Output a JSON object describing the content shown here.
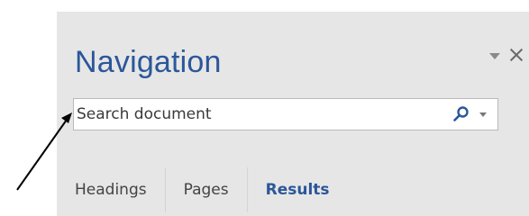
{
  "pane": {
    "title": "Navigation",
    "controls": {
      "options_icon": "dropdown-caret",
      "close_icon": "close-x"
    }
  },
  "search": {
    "placeholder": "Search document",
    "search_icon": "magnifier",
    "options_icon": "dropdown-caret"
  },
  "tabs": [
    {
      "label": "Headings",
      "active": false
    },
    {
      "label": "Pages",
      "active": false
    },
    {
      "label": "Results",
      "active": true
    }
  ],
  "colors": {
    "accent": "#2b579a",
    "pane_background": "#e6e6e6",
    "text": "#444444"
  },
  "annotation": {
    "icon": "pointer-arrow"
  }
}
